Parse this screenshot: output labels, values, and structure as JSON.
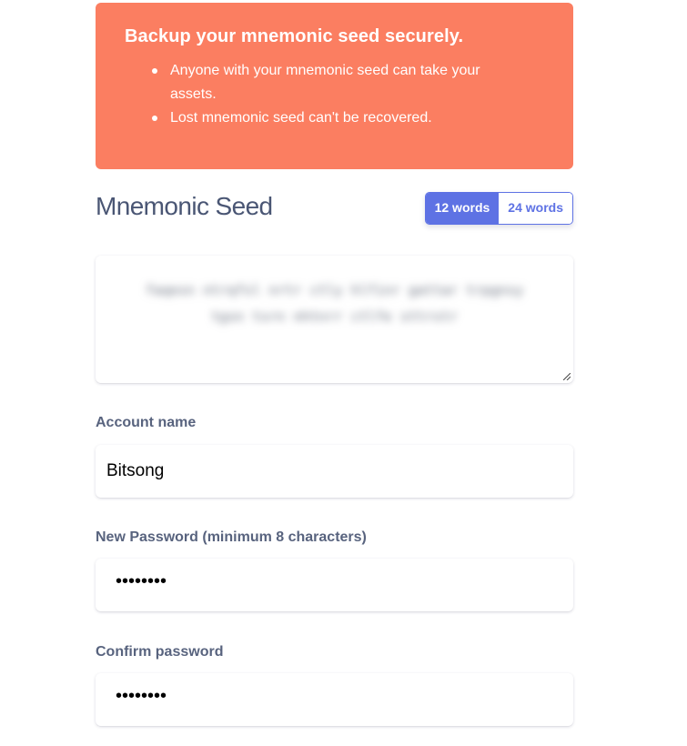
{
  "warning": {
    "title": "Backup your mnemonic seed securely.",
    "items": [
      "Anyone with your mnemonic seed can take your assets.",
      "Lost mnemonic seed can't be recovered."
    ]
  },
  "seed": {
    "title": "Mnemonic Seed",
    "toggle": {
      "option_12": "12 words",
      "option_24": "24 words",
      "selected": "12 words"
    },
    "blurred_text": "faqesn ntrqfsl nrtr ctly hlfinr gattar  trpgnsy tgsn tsrn nhtnrr ctlfe  sttrstr"
  },
  "form": {
    "account_name_label": "Account name",
    "account_name_value": "Bitsong",
    "new_password_label": "New Password (minimum 8 characters)",
    "new_password_value": "••••••••",
    "confirm_password_label": "Confirm password",
    "confirm_password_value": "••••••••"
  },
  "colors": {
    "warning_bg": "#fb7e61",
    "accent": "#5e72e4",
    "heading": "#4a5674"
  }
}
